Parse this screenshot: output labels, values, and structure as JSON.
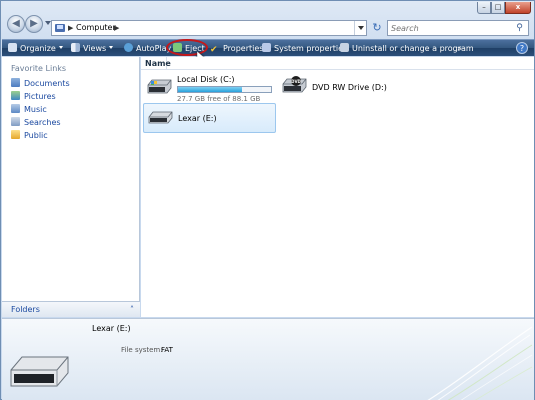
{
  "address": {
    "path": "Computer",
    "search_placeholder": "Search"
  },
  "window_controls": {
    "minimize": "–",
    "maximize": "□",
    "close": "x"
  },
  "toolbar": {
    "organize": "Organize",
    "views": "Views",
    "autoplay": "AutoPlay",
    "eject": "Eject",
    "properties": "Properties",
    "system_properties": "System properties",
    "uninstall": "Uninstall or change a program",
    "more": "»",
    "help": "?"
  },
  "sidebar": {
    "title": "Favorite Links",
    "items": [
      {
        "label": "Documents",
        "icon": "documents-icon"
      },
      {
        "label": "Pictures",
        "icon": "pictures-icon"
      },
      {
        "label": "Music",
        "icon": "music-icon"
      },
      {
        "label": "Searches",
        "icon": "searches-icon"
      },
      {
        "label": "Public",
        "icon": "public-icon"
      }
    ],
    "folders_label": "Folders",
    "folders_chevron": "˄"
  },
  "main": {
    "column_header": "Name",
    "drives": [
      {
        "label": "Local Disk (C:)",
        "free": "27.7 GB free of 88.1 GB",
        "used_fraction": 0.69
      },
      {
        "label": "DVD RW Drive (D:)",
        "badge": "DVD"
      },
      {
        "label": "Lexar (E:)"
      }
    ]
  },
  "details": {
    "name": "Lexar (E:)",
    "fs_label": "File system:",
    "fs_value": "FAT"
  },
  "colors": {
    "toolbar": "#2c4f7a",
    "link": "#1c4aa0",
    "selection": "#d8ebfb",
    "highlight_circle": "#c4181b",
    "progress": "#2aa2dc"
  }
}
